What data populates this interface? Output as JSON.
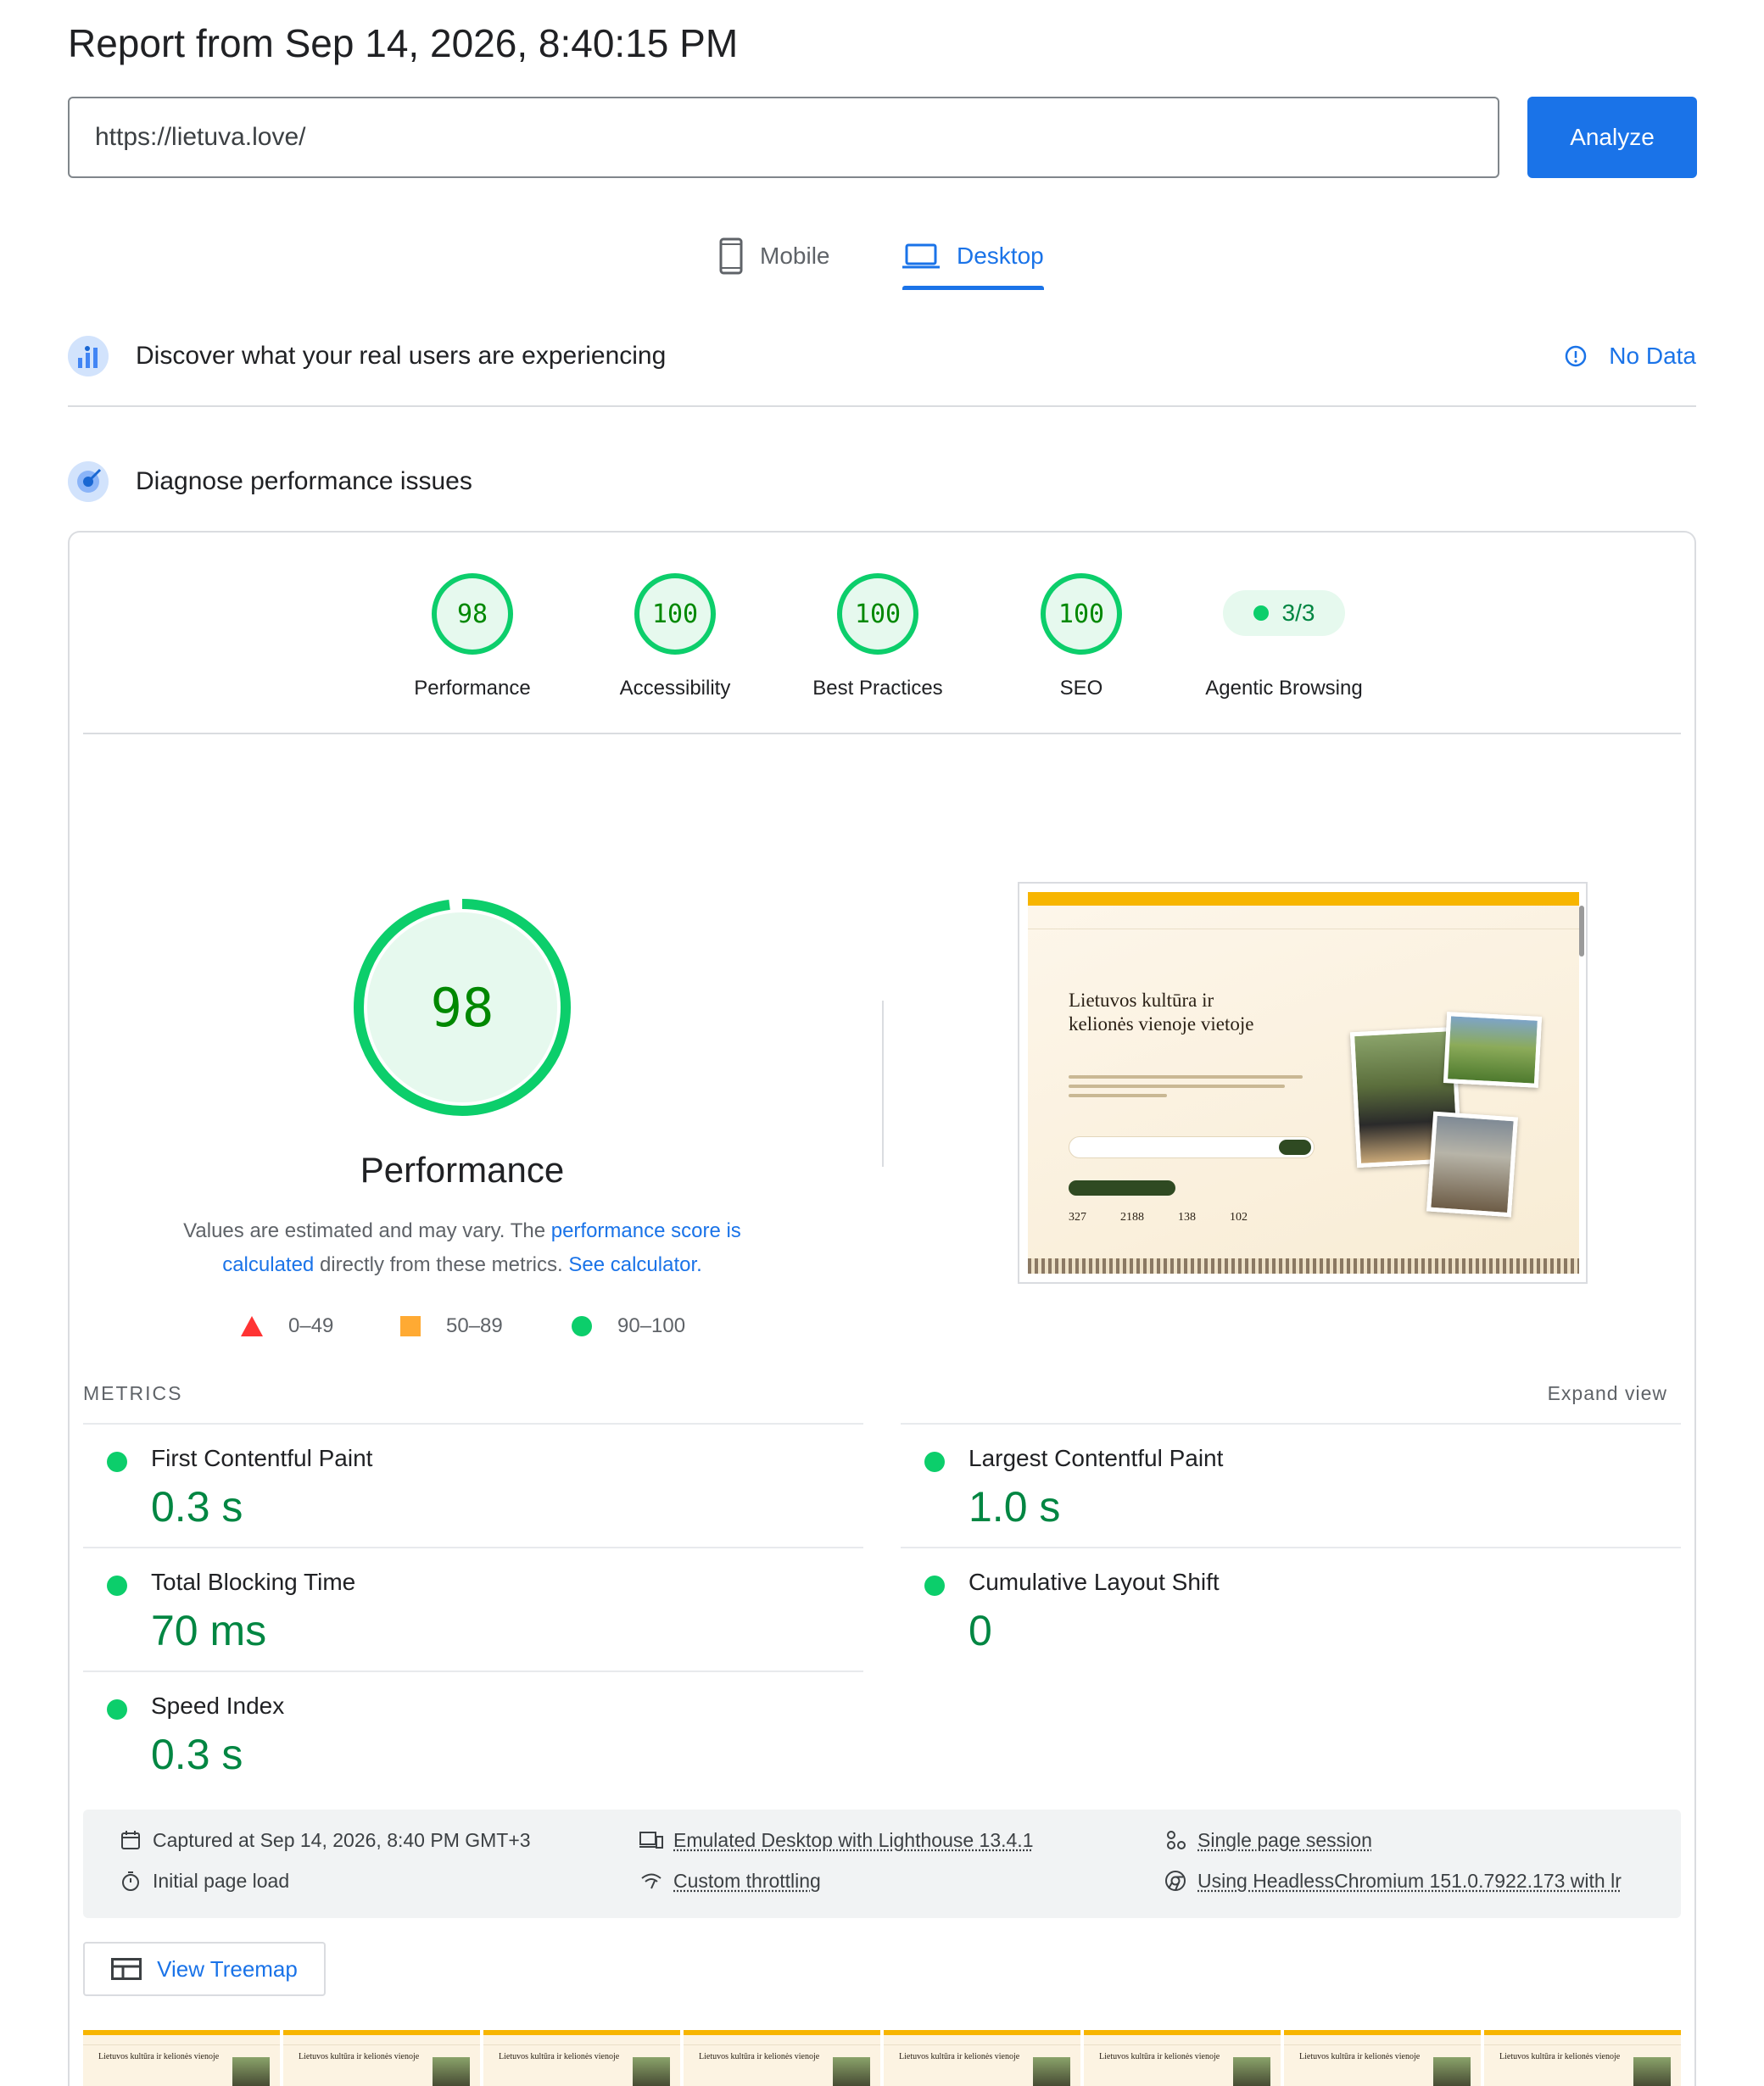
{
  "report": {
    "title": "Report from Sep 14, 2026, 8:40:15 PM"
  },
  "search": {
    "url": "https://lietuva.love/",
    "analyze_label": "Analyze"
  },
  "tabs": [
    {
      "label": "Mobile",
      "icon": "phone-icon",
      "active": false
    },
    {
      "label": "Desktop",
      "icon": "laptop-icon",
      "active": true
    }
  ],
  "field_data": {
    "title": "Discover what your real users are experiencing",
    "status": "No Data"
  },
  "diagnose": {
    "title": "Diagnose performance issues"
  },
  "categories": [
    {
      "label": "Performance",
      "score": "98"
    },
    {
      "label": "Accessibility",
      "score": "100"
    },
    {
      "label": "Best Practices",
      "score": "100"
    },
    {
      "label": "SEO",
      "score": "100"
    },
    {
      "label": "Agentic Browsing",
      "score": "3/3"
    }
  ],
  "performance": {
    "score": "98",
    "score_fraction": 0.98,
    "title": "Performance",
    "desc_prefix": "Values are estimated and may vary. The ",
    "desc_link1": "performance score is calculated",
    "desc_middle": " directly from these metrics. ",
    "desc_link2": "See calculator."
  },
  "legend": [
    {
      "range": "0–49",
      "shape": "triangle",
      "color": "#ff3333"
    },
    {
      "range": "50–89",
      "shape": "square",
      "color": "#ffaa33"
    },
    {
      "range": "90–100",
      "shape": "circle",
      "color": "#0cce6b"
    }
  ],
  "screenshot": {
    "heading": "Lietuvos kultūra ir kelionės vienoje vietoje",
    "stats": [
      "327",
      "2188",
      "138",
      "102"
    ]
  },
  "metrics_header": {
    "label": "METRICS",
    "expand": "Expand view"
  },
  "metrics": [
    {
      "name": "First Contentful Paint",
      "value": "0.3 s"
    },
    {
      "name": "Largest Contentful Paint",
      "value": "1.0 s"
    },
    {
      "name": "Total Blocking Time",
      "value": "70 ms"
    },
    {
      "name": "Cumulative Layout Shift",
      "value": "0"
    },
    {
      "name": "Speed Index",
      "value": "0.3 s"
    }
  ],
  "runtime": {
    "captured": "Captured at Sep 14, 2026, 8:40 PM GMT+3",
    "initial_load": "Initial page load",
    "emulated": "Emulated Desktop with Lighthouse 13.4.1",
    "throttling": "Custom throttling",
    "session": "Single page session",
    "browser": "Using HeadlessChromium 151.0.7922.173 with lr"
  },
  "treemap": {
    "label": "View Treemap"
  },
  "filmstrip": {
    "frame_heading": "Lietuvos kultūra ir kelionės vienoje"
  },
  "colors": {
    "accent": "#1a73e8",
    "pass": "#0cce6b",
    "pass_text": "#018642"
  }
}
